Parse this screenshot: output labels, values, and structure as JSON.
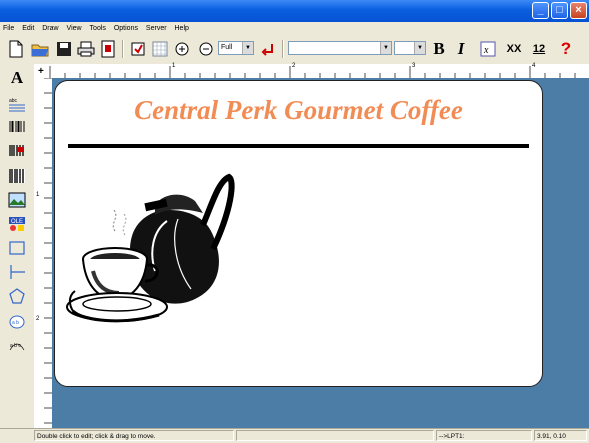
{
  "menu": [
    "File",
    "Edit",
    "Draw",
    "View",
    "Tools",
    "Options",
    "Server",
    "Help"
  ],
  "toolbar": {
    "zoom_value": "Full",
    "font_name": "",
    "font_size": "",
    "bold_label": "B",
    "italic_label": "I",
    "xx_label": "XX",
    "twelve_label": "12",
    "help_label": "?"
  },
  "ruler": {
    "marks": [
      "1",
      "2",
      "3",
      "4"
    ]
  },
  "label": {
    "title": "Central Perk Gourmet Coffee"
  },
  "status": {
    "hint": "Double click to edit; click & drag to move.",
    "printer": "-->LPT1:",
    "coords": "3.91, 0.10"
  },
  "colors": {
    "titlebar": "#0a5fe0",
    "title_text": "#f28c55",
    "canvas_bg": "#4c7da6"
  }
}
